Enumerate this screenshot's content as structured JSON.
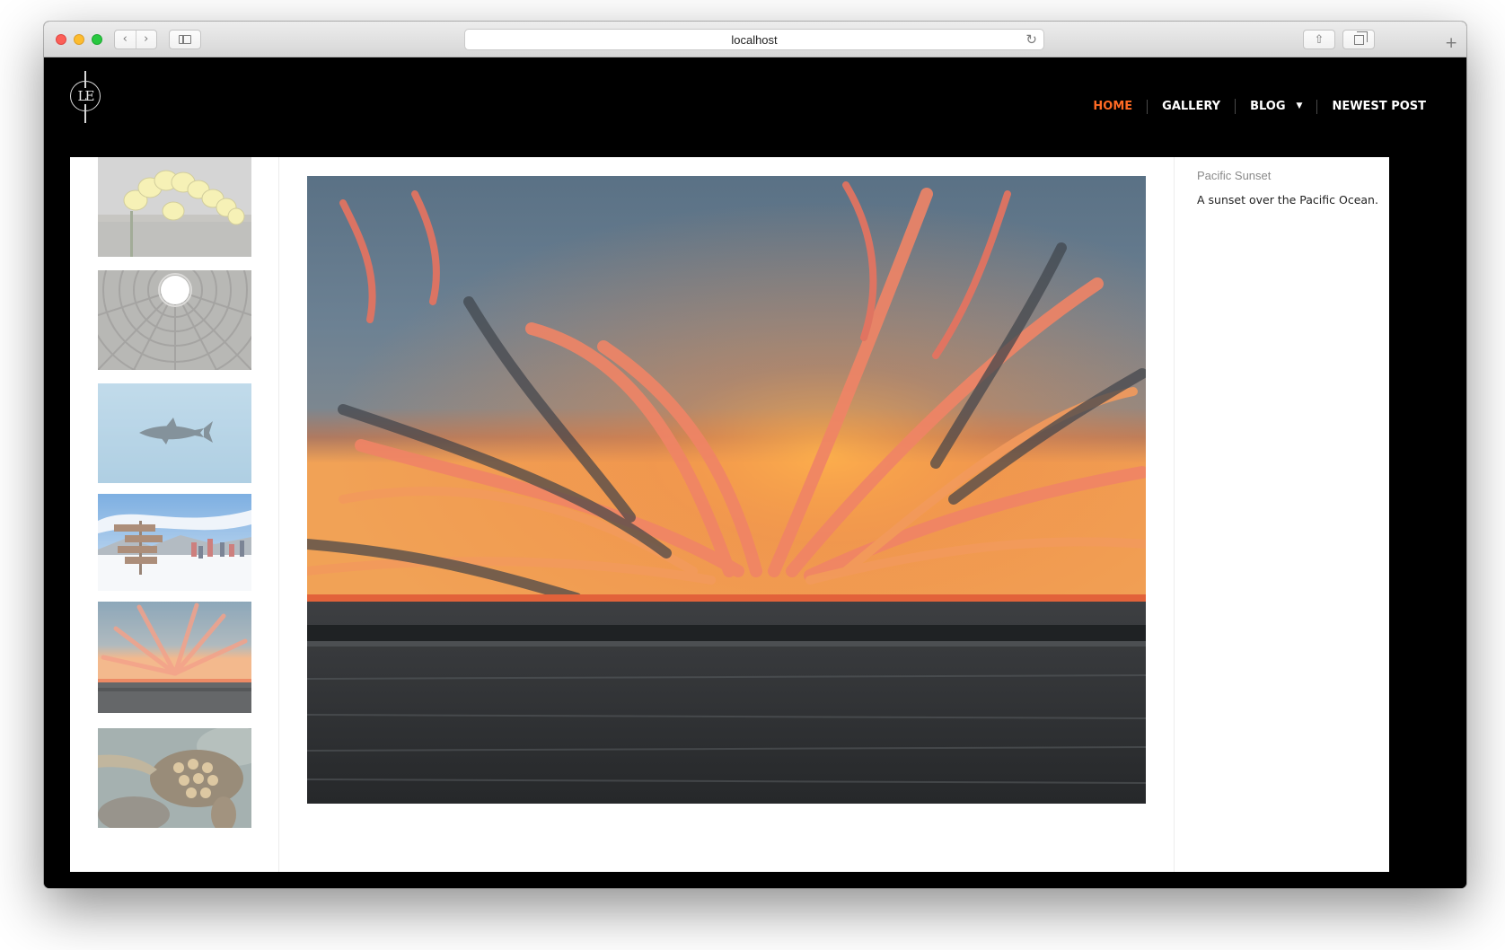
{
  "browser": {
    "url": "localhost"
  },
  "nav": {
    "items": [
      {
        "label": "HOME",
        "active": true
      },
      {
        "label": "GALLERY",
        "active": false
      },
      {
        "label": "BLOG",
        "active": false,
        "has_dropdown": true
      },
      {
        "label": "NEWEST POST",
        "active": false
      }
    ]
  },
  "logo": {
    "text": "LE"
  },
  "gallery": {
    "thumbnails": [
      {
        "subject": "yellow orchids"
      },
      {
        "subject": "pantheon dome oculus"
      },
      {
        "subject": "shark"
      },
      {
        "subject": "ski resort signpost"
      },
      {
        "subject": "pacific sunset",
        "selected": true
      },
      {
        "subject": "sea turtle"
      }
    ],
    "main_image": {
      "subject": "Pacific Sunset"
    }
  },
  "photo": {
    "title": "Pacific Sunset",
    "description": "A sunset over the Pacific Ocean."
  },
  "colors": {
    "accent": "#ff6a24",
    "header_bg": "#000000",
    "content_bg": "#ffffff"
  }
}
